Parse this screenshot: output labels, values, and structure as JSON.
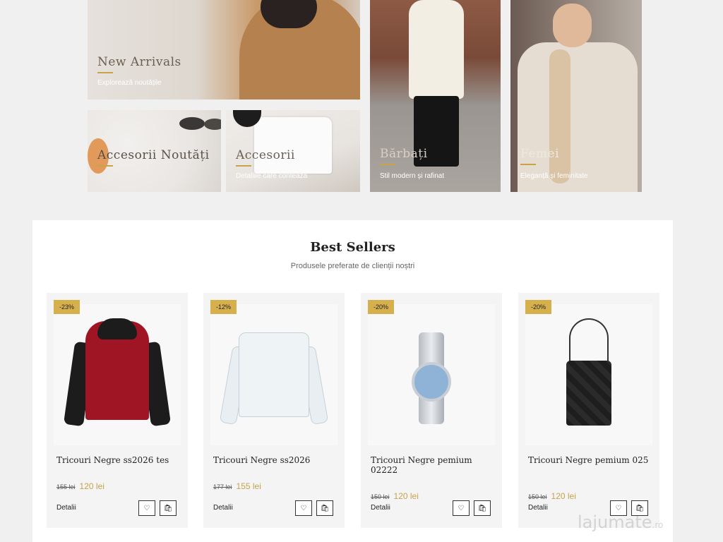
{
  "categories": {
    "new_arrivals": {
      "title": "New Arrivals",
      "subtitle": "Explorează noutățile"
    },
    "accessories_new": {
      "title": "Accesorii Noutăți"
    },
    "accessories": {
      "title": "Accesorii",
      "subtitle": "Detaliile care contează"
    },
    "men": {
      "title": "Bărbați",
      "subtitle": "Stil modern și rafinat"
    },
    "women": {
      "title": "Femei",
      "subtitle": "Eleganță și feminitate"
    }
  },
  "best_sellers": {
    "title": "Best Sellers",
    "subtitle": "Produsele preferate de clienții noștri",
    "details_label": "Detalii",
    "products": [
      {
        "badge": "-23%",
        "name": "Tricouri Negre ss2026 tes",
        "old_price": "155 lei",
        "price": "120 lei"
      },
      {
        "badge": "-12%",
        "name": "Tricouri Negre ss2026",
        "old_price": "177 lei",
        "price": "155 lei"
      },
      {
        "badge": "-20%",
        "name": "Tricouri Negre pemium 02222",
        "old_price": "150 lei",
        "price": "120 lei"
      },
      {
        "badge": "-20%",
        "name": "Tricouri Negre pemium 025",
        "old_price": "150 lei",
        "price": "120 lei"
      }
    ]
  },
  "watermark": {
    "text": "lajumate",
    "suffix": ".ro"
  },
  "colors": {
    "accent": "#c9a24a",
    "badge": "#d6b04c",
    "page_bg": "#f0f0f0"
  },
  "icons": {
    "wishlist": "heart-icon",
    "cart": "shopping-bag-icon"
  }
}
